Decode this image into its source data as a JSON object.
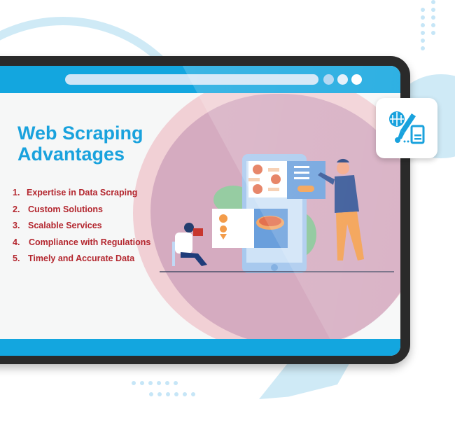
{
  "hero": {
    "title_line1": "Web Scraping",
    "title_line2": "Advantages"
  },
  "advantages": [
    {
      "num": "1.",
      "label": "Expertise in Data Scraping"
    },
    {
      "num": "2.",
      "label": "Custom Solutions"
    },
    {
      "num": "3.",
      "label": "Scalable Services"
    },
    {
      "num": "4.",
      "label": "Compliance with Regulations"
    },
    {
      "num": "5.",
      "label": "Timely and Accurate Data"
    }
  ],
  "icons": {
    "feature_card": "globe-pen-document-icon",
    "browser_dots": [
      "dot-light-blue",
      "dot-lighter",
      "dot-white"
    ]
  },
  "colors": {
    "brand_blue": "#13a6df",
    "title_blue": "#19a2dd",
    "list_red": "#b3262e",
    "bezel": "#2a2a2a",
    "accent_orange": "#f39c4a"
  }
}
